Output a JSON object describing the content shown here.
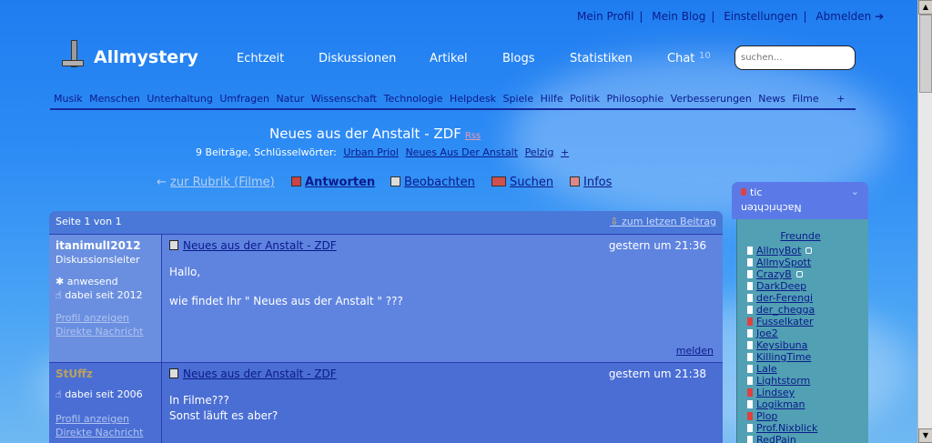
{
  "topnav": [
    "Mein Profil",
    "Mein Blog",
    "Einstellungen",
    "Abmelden ➔"
  ],
  "brand": "Allmystery",
  "mainnav": [
    "Echtzeit",
    "Diskussionen",
    "Artikel",
    "Blogs",
    "Statistiken",
    "Chat"
  ],
  "chat_count": "10",
  "search_placeholder": "suchen...",
  "categories": [
    "Musik",
    "Menschen",
    "Unterhaltung",
    "Umfragen",
    "Natur",
    "Wissenschaft",
    "Technologie",
    "Helpdesk",
    "Spiele",
    "Hilfe",
    "Politik",
    "Philosophie",
    "Verbesserungen",
    "News",
    "Filme",
    "+"
  ],
  "thread": {
    "title": "Neues aus der Anstalt - ZDF",
    "rss": "Rss",
    "meta_prefix": "9 Beiträge, Schlüsselwörter:",
    "keywords": [
      "Urban Priol",
      "Neues Aus Der Anstalt",
      "Pelzig",
      "+"
    ]
  },
  "actions": {
    "back": "zur Rubrik (Filme)",
    "reply": "Antworten",
    "watch": "Beobachten",
    "search": "Suchen",
    "info": "Infos"
  },
  "forum": {
    "page": "Seite 1 von 1",
    "last_post": "zum letzen Beitrag"
  },
  "posts": [
    {
      "user": "itanimulI2012",
      "role": "Diskussionsleiter",
      "status": "anwesend",
      "since": "dabei seit 2012",
      "profile": "Profil anzeigen",
      "message": "Direkte Nachricht",
      "title": "Neues aus der Anstalt - ZDF",
      "time": "gestern um 21:36",
      "lines": [
        "Hallo,",
        "wie findet Ihr \" Neues aus der Anstalt \" ???"
      ],
      "report": "melden"
    },
    {
      "user": "StUffz",
      "since": "dabei seit 2006",
      "profile": "Profil anzeigen",
      "message": "Direkte Nachricht",
      "title": "Neues aus der Anstalt - ZDF",
      "time": "gestern um 21:38",
      "lines": [
        "In Filme???",
        "Sonst läuft es aber?"
      ]
    }
  ],
  "panel": {
    "user": "tic",
    "flipped": "Nachrichten",
    "friends_label": "Freunde",
    "friends": [
      "AllmyBot",
      "AllmySpott",
      "CrazyB",
      "DarkDeep",
      "der-Ferengi",
      "der_chegga",
      "Fusselkater",
      "Joe2",
      "Keysibuna",
      "KillingTime",
      "Lale",
      "Lightstorm",
      "Lindsey",
      "Logikman",
      "Plop",
      "Prof.Nixblick",
      "RedPain"
    ]
  }
}
